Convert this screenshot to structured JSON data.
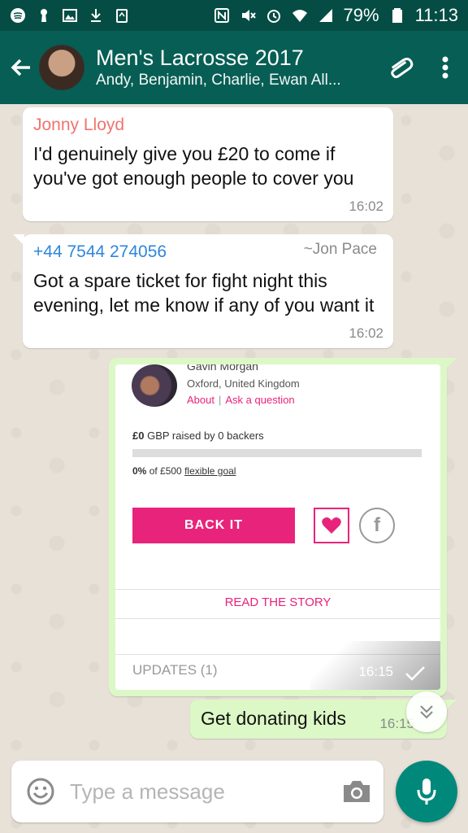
{
  "status_bar": {
    "battery": "79%",
    "time": "11:13"
  },
  "chat": {
    "title": "Men's Lacrosse 2017",
    "subtitle": "Andy, Benjamin, Charlie, Ewan All..."
  },
  "messages": [
    {
      "sender": "Jonny Lloyd",
      "sender_color": "#f07470",
      "text": "I'd genuinely give you £20 to come if you've got enough people to cover you",
      "time": "16:02"
    },
    {
      "sender": "+44 7544 274056",
      "sender_color": "#2e86de",
      "alias": "~Jon Pace",
      "text": "Got a spare ticket for fight night this evening, let me know if any of you want it",
      "time": "16:02"
    }
  ],
  "shared_card": {
    "name": "Gavin Morgan",
    "location": "Oxford, United Kingdom",
    "about_link": "About",
    "ask_link": "Ask a question",
    "raised_amount": "£0",
    "raised_text": "GBP raised by 0 backers",
    "progress_fraction": 0,
    "goal_percent": "0%",
    "goal_of": "of £500",
    "goal_type": "flexible goal",
    "back_button": "BACK IT",
    "read_story": "READ THE STORY",
    "updates": "UPDATES (1)",
    "time": "16:15"
  },
  "outgoing": {
    "text": "Get donating kids",
    "time": "16:15"
  },
  "input": {
    "placeholder": "Type a message"
  },
  "colors": {
    "header": "#075e54",
    "status_bar": "#054d44",
    "accent_pink": "#e8237b",
    "outgoing_bubble": "#dcf8c6",
    "mic_button": "#00897b"
  }
}
